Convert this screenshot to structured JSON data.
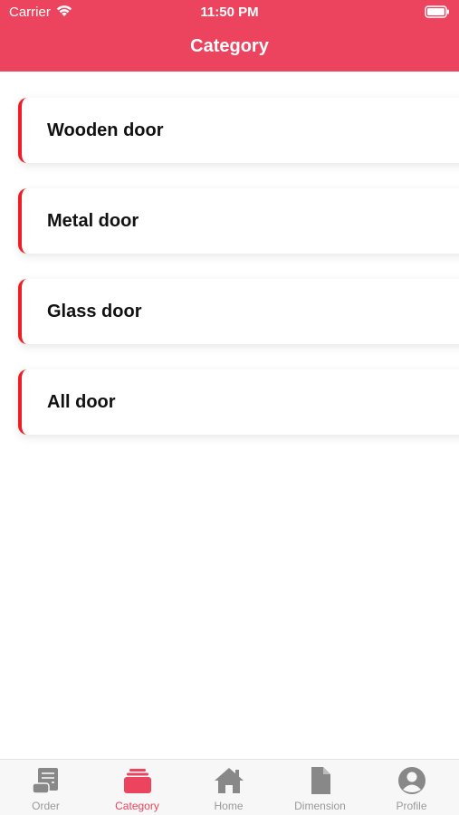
{
  "status_bar": {
    "carrier": "Carrier",
    "time": "11:50 PM"
  },
  "header": {
    "title": "Category"
  },
  "categories": [
    {
      "label": "Wooden door"
    },
    {
      "label": "Metal door"
    },
    {
      "label": "Glass door"
    },
    {
      "label": "All door"
    }
  ],
  "tabs": [
    {
      "label": "Order",
      "icon": "scroll-icon"
    },
    {
      "label": "Category",
      "icon": "category-icon",
      "active": true
    },
    {
      "label": "Home",
      "icon": "home-icon"
    },
    {
      "label": "Dimension",
      "icon": "document-icon"
    },
    {
      "label": "Profile",
      "icon": "profile-icon"
    }
  ],
  "colors": {
    "primary": "#ec445e",
    "card_accent": "#ee1c25",
    "tab_inactive": "#999999",
    "tab_icon_inactive": "#888888"
  }
}
